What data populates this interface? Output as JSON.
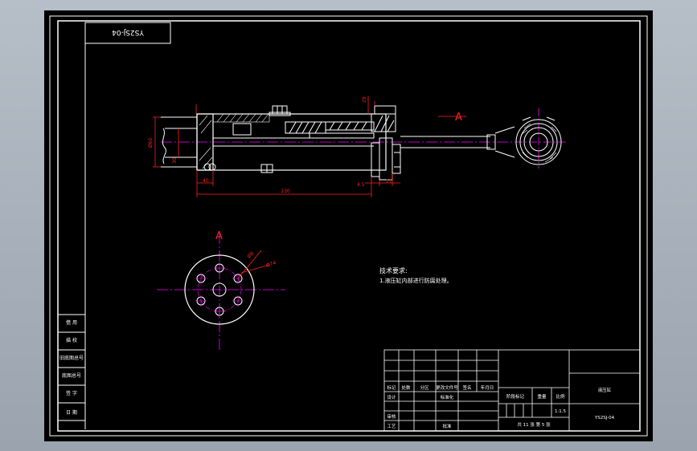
{
  "drawing": {
    "rotated_code": "YS2SJ-04",
    "section_label": "A",
    "view_label": "A",
    "tech_req_title": "技术要求:",
    "tech_req_item": "1.液压缸内部进行防腐处理。",
    "dims": {
      "overall_length": "230",
      "left_offset": "40",
      "right_a": "4.5",
      "right_b": "21",
      "top_small": "29",
      "diameter_left": "Ø60",
      "diameter_small": "30",
      "flange_hole": "Ø8",
      "bolt_circle": "Ø74"
    }
  },
  "side_table": {
    "rows": [
      "借 用",
      "描 校",
      "旧底图总号",
      "底图总号",
      "签 字",
      "日 期"
    ]
  },
  "title_block": {
    "headers": [
      "标记",
      "处数",
      "分区",
      "更改文件号",
      "签名",
      "年月日"
    ],
    "design": "设计",
    "standardize": "标准化",
    "review": "审核",
    "process": "工艺",
    "approve": "批准",
    "stage_mark": "阶段标记",
    "weight": "重量",
    "scale": "比例",
    "scale_value": "1:1.5",
    "sheets": "共 11 张 第 5 张",
    "part_name": "液压缸",
    "drawing_code": "YS2SJ-04"
  },
  "colors": {
    "frame": "#ffffff",
    "part": "#ffffff",
    "dimension": "#ff2020",
    "centerline": "#ff00ff",
    "hatch": "#ffffff",
    "accent": "#ffff00"
  }
}
